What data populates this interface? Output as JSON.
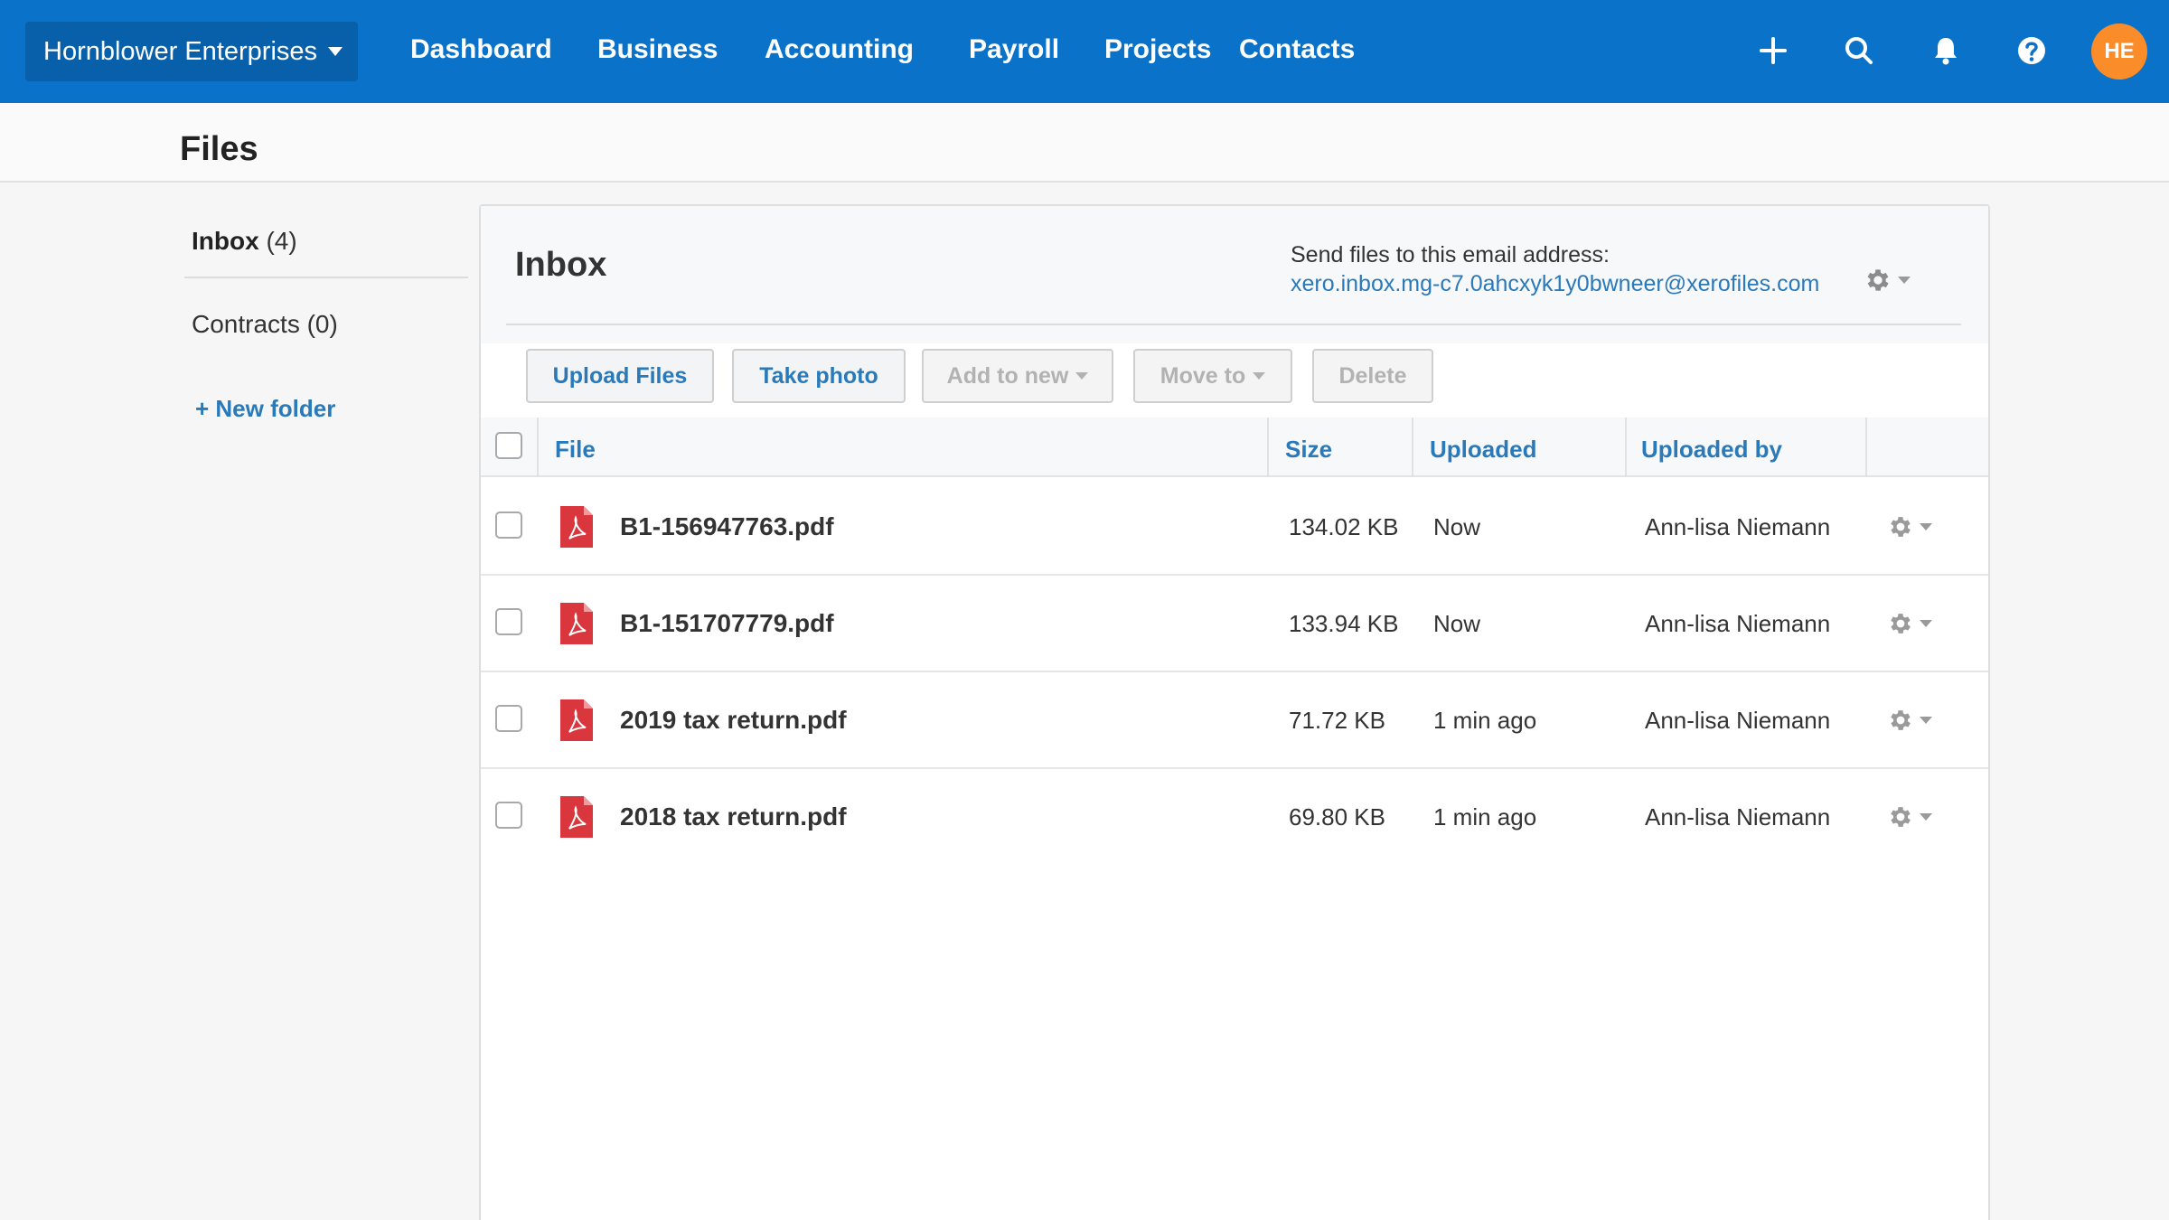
{
  "topnav": {
    "org_name": "Hornblower Enterprises",
    "links": [
      "Dashboard",
      "Business",
      "Accounting",
      "Payroll",
      "Projects",
      "Contacts"
    ],
    "icons": [
      "plus-icon",
      "search-icon",
      "bell-icon",
      "help-icon"
    ],
    "avatar_initials": "HE",
    "colors": {
      "bar": "#0a73c9",
      "org_switcher": "#0960aa",
      "avatar": "#fa8d29"
    }
  },
  "page": {
    "title": "Files"
  },
  "sidebar": {
    "folders": [
      {
        "name": "Inbox",
        "count": "(4)"
      },
      {
        "name": "Contracts",
        "count": "(0)"
      }
    ],
    "new_folder_label": "+ New folder"
  },
  "panel": {
    "title": "Inbox",
    "email_label": "Send files to this email address:",
    "email_address": "xero.inbox.mg-c7.0ahcxyk1y0bwneer@xerofiles.com",
    "toolbar": {
      "upload": "Upload Files",
      "take_photo": "Take photo",
      "add_to_new": "Add to new",
      "move_to": "Move to",
      "delete": "Delete"
    },
    "columns": {
      "file": "File",
      "size": "Size",
      "uploaded": "Uploaded",
      "uploaded_by": "Uploaded by"
    },
    "files": [
      {
        "name": "B1-156947763.pdf",
        "size": "134.02 KB",
        "uploaded": "Now",
        "uploaded_by": "Ann-lisa Niemann"
      },
      {
        "name": "B1-151707779.pdf",
        "size": "133.94 KB",
        "uploaded": "Now",
        "uploaded_by": "Ann-lisa Niemann"
      },
      {
        "name": "2019 tax return.pdf",
        "size": "71.72 KB",
        "uploaded": "1 min ago",
        "uploaded_by": "Ann-lisa Niemann"
      },
      {
        "name": "2018 tax return.pdf",
        "size": "69.80 KB",
        "uploaded": "1 min ago",
        "uploaded_by": "Ann-lisa Niemann"
      }
    ],
    "colors": {
      "link": "#2a79b8",
      "pdf": "#d9363e"
    }
  }
}
